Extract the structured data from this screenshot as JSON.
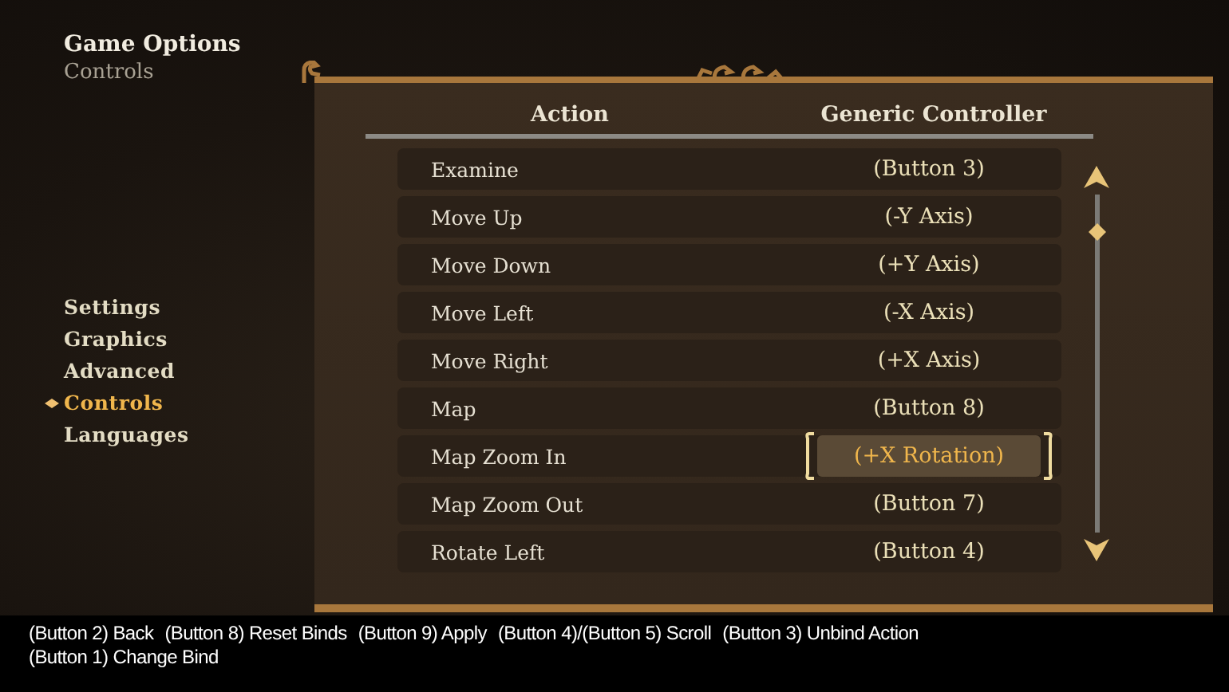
{
  "header": {
    "title": "Game Options",
    "subtitle": "Controls"
  },
  "nav": [
    {
      "label": "Settings",
      "selected": false
    },
    {
      "label": "Graphics",
      "selected": false
    },
    {
      "label": "Advanced",
      "selected": false
    },
    {
      "label": "Controls",
      "selected": true
    },
    {
      "label": "Languages",
      "selected": false
    }
  ],
  "table": {
    "columns": [
      "Action",
      "Generic Controller"
    ],
    "rows": [
      {
        "action": "Examine",
        "binding": "(Button 3)",
        "selected": false
      },
      {
        "action": "Move Up",
        "binding": "(-Y Axis)",
        "selected": false
      },
      {
        "action": "Move Down",
        "binding": "(+Y Axis)",
        "selected": false
      },
      {
        "action": "Move Left",
        "binding": "(-X Axis)",
        "selected": false
      },
      {
        "action": "Move Right",
        "binding": "(+X Axis)",
        "selected": false
      },
      {
        "action": "Map",
        "binding": "(Button 8)",
        "selected": false
      },
      {
        "action": "Map Zoom In",
        "binding": "(+X Rotation)",
        "selected": true
      },
      {
        "action": "Map Zoom Out",
        "binding": "(Button 7)",
        "selected": false
      },
      {
        "action": "Rotate Left",
        "binding": "(Button 4)",
        "selected": false
      }
    ]
  },
  "hints": [
    "(Button 2) Back",
    "(Button 8) Reset Binds",
    "(Button 9) Apply",
    "(Button 4)/(Button 5) Scroll",
    "(Button 3) Unbind Action",
    "(Button 1) Change Bind"
  ]
}
